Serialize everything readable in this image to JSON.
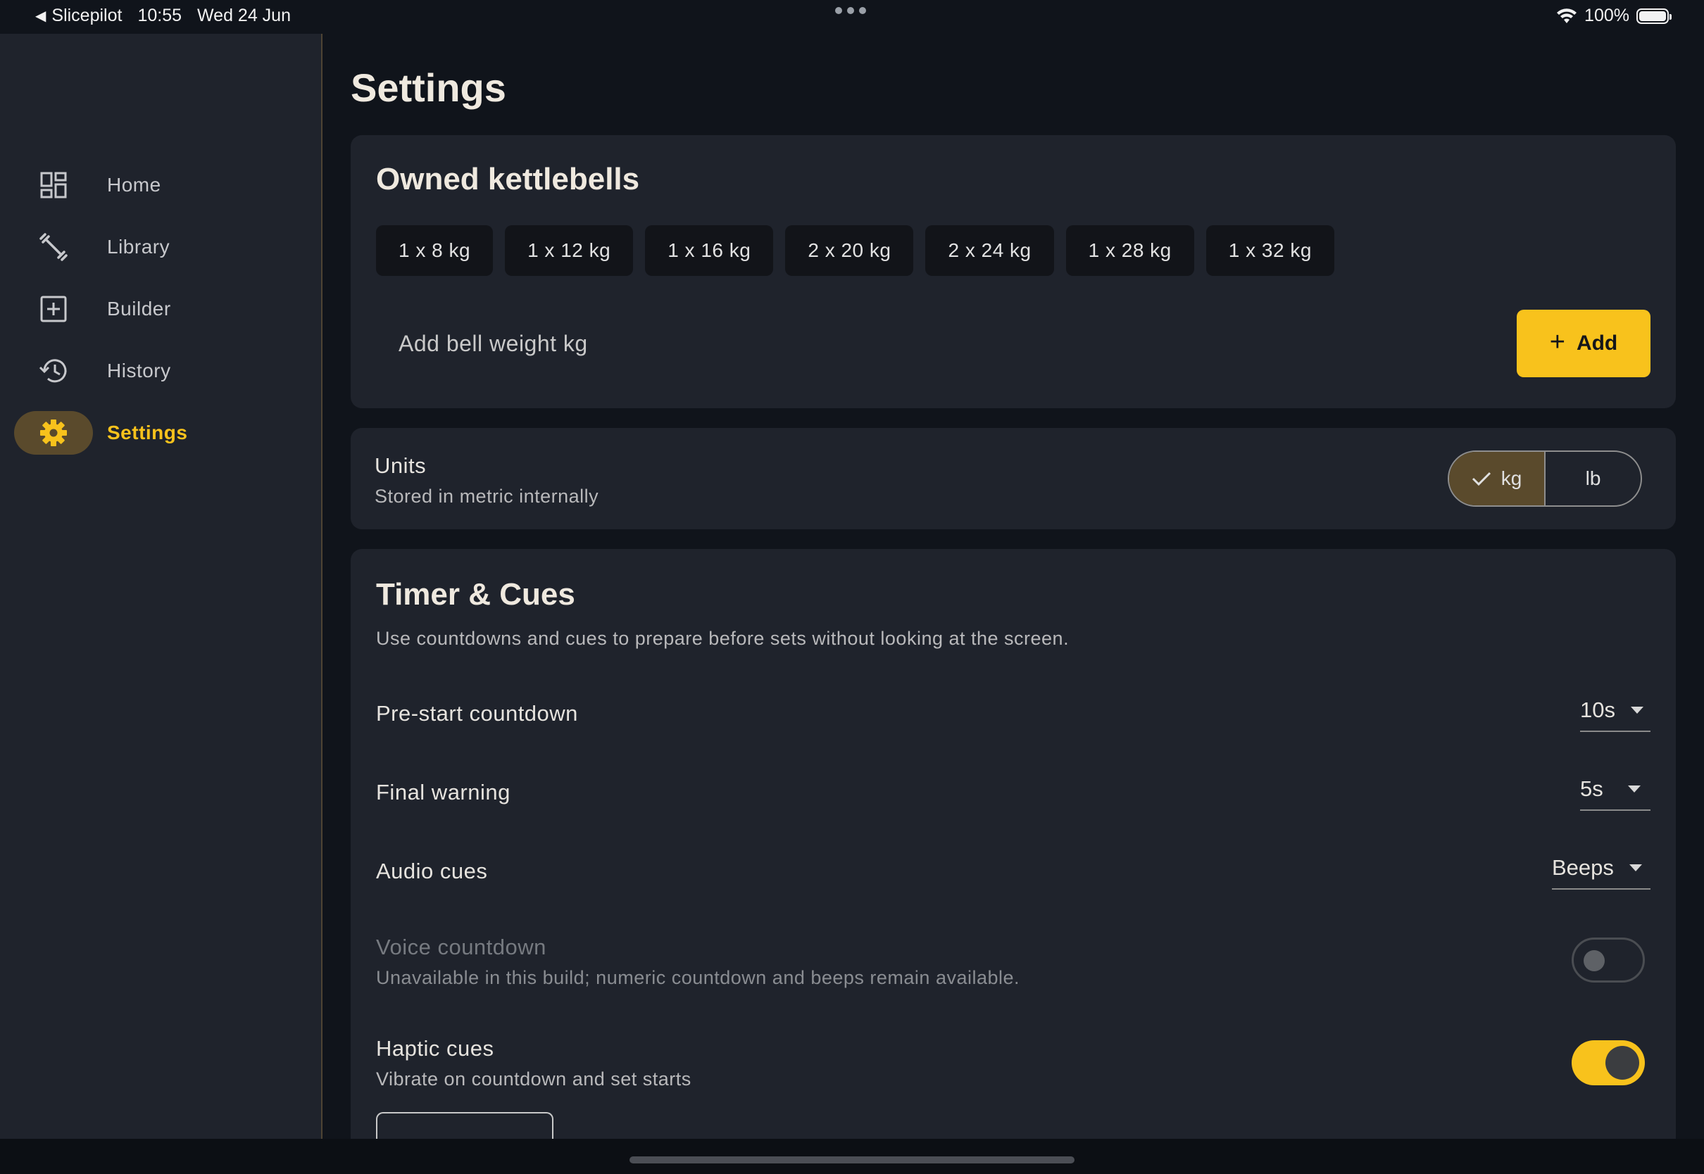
{
  "status_bar": {
    "back_app": "Slicepilot",
    "time": "10:55",
    "date": "Wed 24 Jun",
    "battery": "100%"
  },
  "sidebar": {
    "items": [
      {
        "label": "Home",
        "icon": "dashboard-icon"
      },
      {
        "label": "Library",
        "icon": "dumbbell-icon"
      },
      {
        "label": "Builder",
        "icon": "add-box-icon"
      },
      {
        "label": "History",
        "icon": "history-icon"
      },
      {
        "label": "Settings",
        "icon": "gear-icon",
        "active": true
      }
    ]
  },
  "page": {
    "title": "Settings"
  },
  "kettlebells": {
    "title": "Owned kettlebells",
    "chips": [
      "1 x 8 kg",
      "1 x 12 kg",
      "1 x 16 kg",
      "2 x 20 kg",
      "2 x 24 kg",
      "1 x 28 kg",
      "1 x 32 kg"
    ],
    "input_placeholder": "Add bell weight kg",
    "add_label": "Add"
  },
  "units": {
    "title": "Units",
    "subtitle": "Stored in metric internally",
    "options": [
      "kg",
      "lb"
    ],
    "selected": "kg"
  },
  "timer": {
    "title": "Timer & Cues",
    "description": "Use countdowns and cues to prepare before sets without looking at the screen.",
    "pre_start": {
      "label": "Pre-start countdown",
      "value": "10s"
    },
    "final_warning": {
      "label": "Final warning",
      "value": "5s"
    },
    "audio_cues": {
      "label": "Audio cues",
      "value": "Beeps"
    },
    "voice_countdown": {
      "label": "Voice countdown",
      "subtitle": "Unavailable in this build; numeric countdown and beeps remain available.",
      "enabled": false
    },
    "haptic_cues": {
      "label": "Haptic cues",
      "subtitle": "Vibrate on countdown and set starts",
      "enabled": true
    }
  },
  "colors": {
    "accent": "#f8c21c",
    "background": "#10141b",
    "surface": "#1f232c"
  }
}
